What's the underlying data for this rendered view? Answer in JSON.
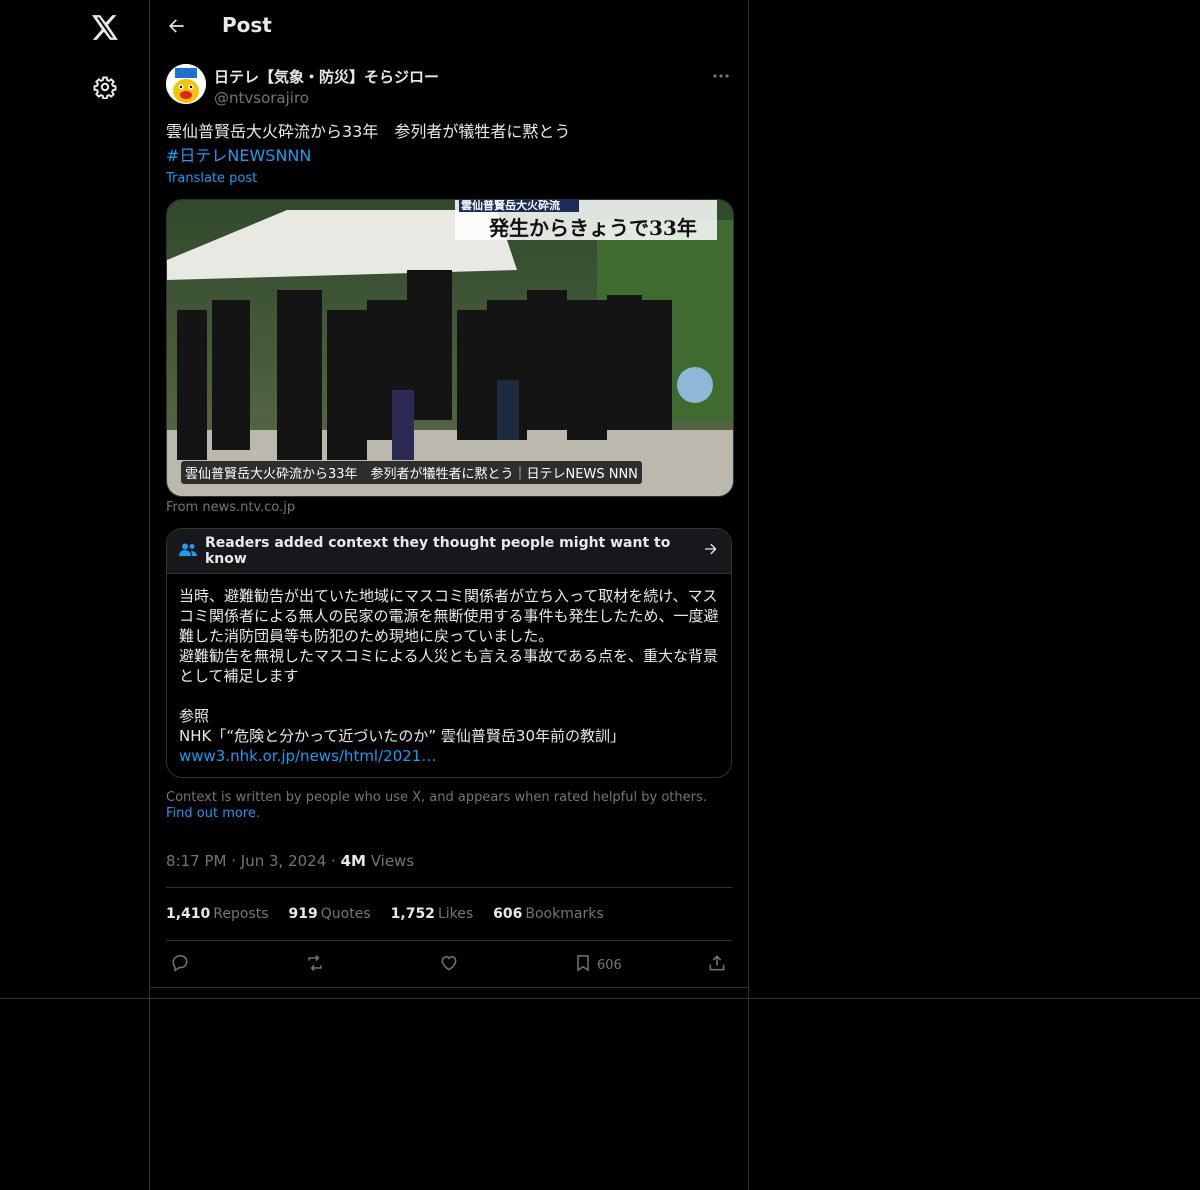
{
  "page": {
    "title": "Post"
  },
  "nav": {
    "icons": [
      "x-logo-icon",
      "gear-icon"
    ]
  },
  "post": {
    "author_name": "日テレ【気象・防災】そらジロー",
    "handle": "@ntvsorajiro",
    "text": "雲仙普賢岳大火砕流から33年　参列者が犠牲者に黙とう",
    "hashtag": "#日テレNEWSNNN",
    "translate": "Translate post",
    "media_overlay_top": "雲仙普賢岳大火砕流",
    "media_headline": "発生からきょうで33年",
    "media_caption": "雲仙普賢岳大火砕流から33年　参列者が犠牲者に黙とう｜日テレNEWS NNN",
    "source": "From news.ntv.co.jp",
    "time": "8:17 PM",
    "date": "Jun 3, 2024",
    "views_count": "4M",
    "views_label": "Views",
    "reposts": "1,410",
    "reposts_label": "Reposts",
    "quotes": "919",
    "quotes_label": "Quotes",
    "likes": "1,752",
    "likes_label": "Likes",
    "bookmarks": "606",
    "bookmarks_label": "Bookmarks",
    "bookmark_action_count": "606"
  },
  "community_note": {
    "header": "Readers added context they thought people might want to know",
    "body": "当時、避難勧告が出ていた地域にマスコミ関係者が立ち入って取材を続け、マスコミ関係者による無人の民家の電源を無断使用する事件も発生したため、一度避難した消防団員等も防犯のため現地に戻っていました。\n避難勧告を無視したマスコミによる人災とも言える事故である点を、重大な背景として補足します\n\n参照\nNHK「“危険と分かって近づいたのか” 雲仙普賢岳30年前の教訓」",
    "link": "www3.nhk.or.jp/news/html/2021…",
    "footer": "Context is written by people who use X, and appears when rated helpful by others.",
    "find_out": "Find out more."
  },
  "colors": {
    "accent": "#1d9bf0",
    "muted": "#71767b",
    "border": "#2f3336",
    "text": "#e7e9ea"
  }
}
